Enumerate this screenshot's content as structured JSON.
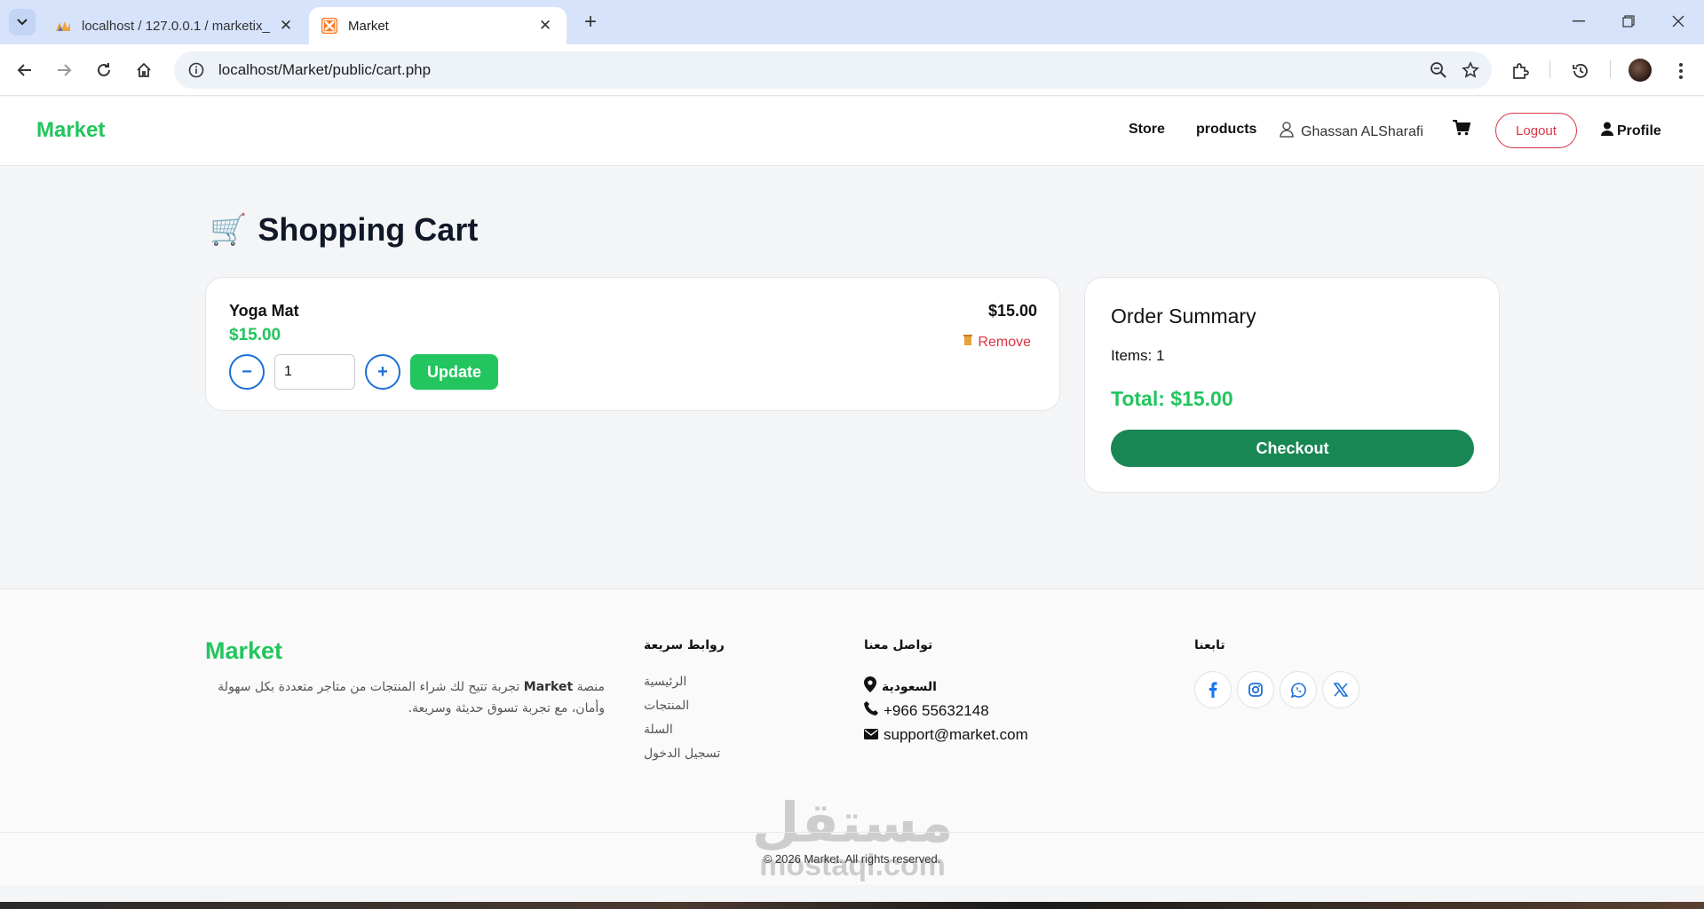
{
  "browser": {
    "tabs": [
      {
        "title": "localhost / 127.0.0.1 / marketix_",
        "favicon": "phpmyadmin-icon",
        "active": false
      },
      {
        "title": "Market",
        "favicon": "xampp-icon",
        "active": true
      }
    ],
    "url": "localhost/Market/public/cart.php"
  },
  "header": {
    "brand": "Market",
    "nav": [
      "Store",
      "products"
    ],
    "user_name": "Ghassan ALSharafi",
    "logout_label": "Logout",
    "profile_label": "Profile"
  },
  "main": {
    "title": "Shopping Cart",
    "title_icon": "🛒",
    "cart_items": [
      {
        "name": "Yoga Mat",
        "price": "$15.00",
        "quantity": "1",
        "line_total": "$15.00",
        "update_label": "Update",
        "remove_label": "Remove",
        "minus_label": "−",
        "plus_label": "+"
      }
    ],
    "summary": {
      "title": "Order Summary",
      "items_text": "Items: 1",
      "total_text": "Total: $15.00",
      "checkout_label": "Checkout"
    }
  },
  "footer": {
    "brand": "Market",
    "desc_brand": "Market",
    "desc_prefix": "منصة",
    "desc_text": "تجربة تتيح لك شراء المنتجات من متاجر متعددة بكل سهولة وأمان، مع تجربة تسوق حديثة وسريعة.",
    "quick_links_heading": "روابط سريعة",
    "quick_links": [
      "الرئيسية",
      "المنتجات",
      "السلة",
      "تسجيل الدخول"
    ],
    "contact_heading": "تواصل معنا",
    "contact": {
      "location": "السعودية",
      "phone": "+966 55632148",
      "email": "support@market.com"
    },
    "follow_heading": "تابعنا",
    "social": [
      "facebook-icon",
      "instagram-icon",
      "whatsapp-icon",
      "x-icon"
    ],
    "copyright": "© 2026 Market. All rights reserved.",
    "watermark_ar": "مستقل",
    "watermark_en": "mostaql.com"
  },
  "colors": {
    "brand_green": "#22c55e",
    "checkout_green": "#198754",
    "danger": "#dc3545",
    "accent_blue": "#1d70d6"
  }
}
